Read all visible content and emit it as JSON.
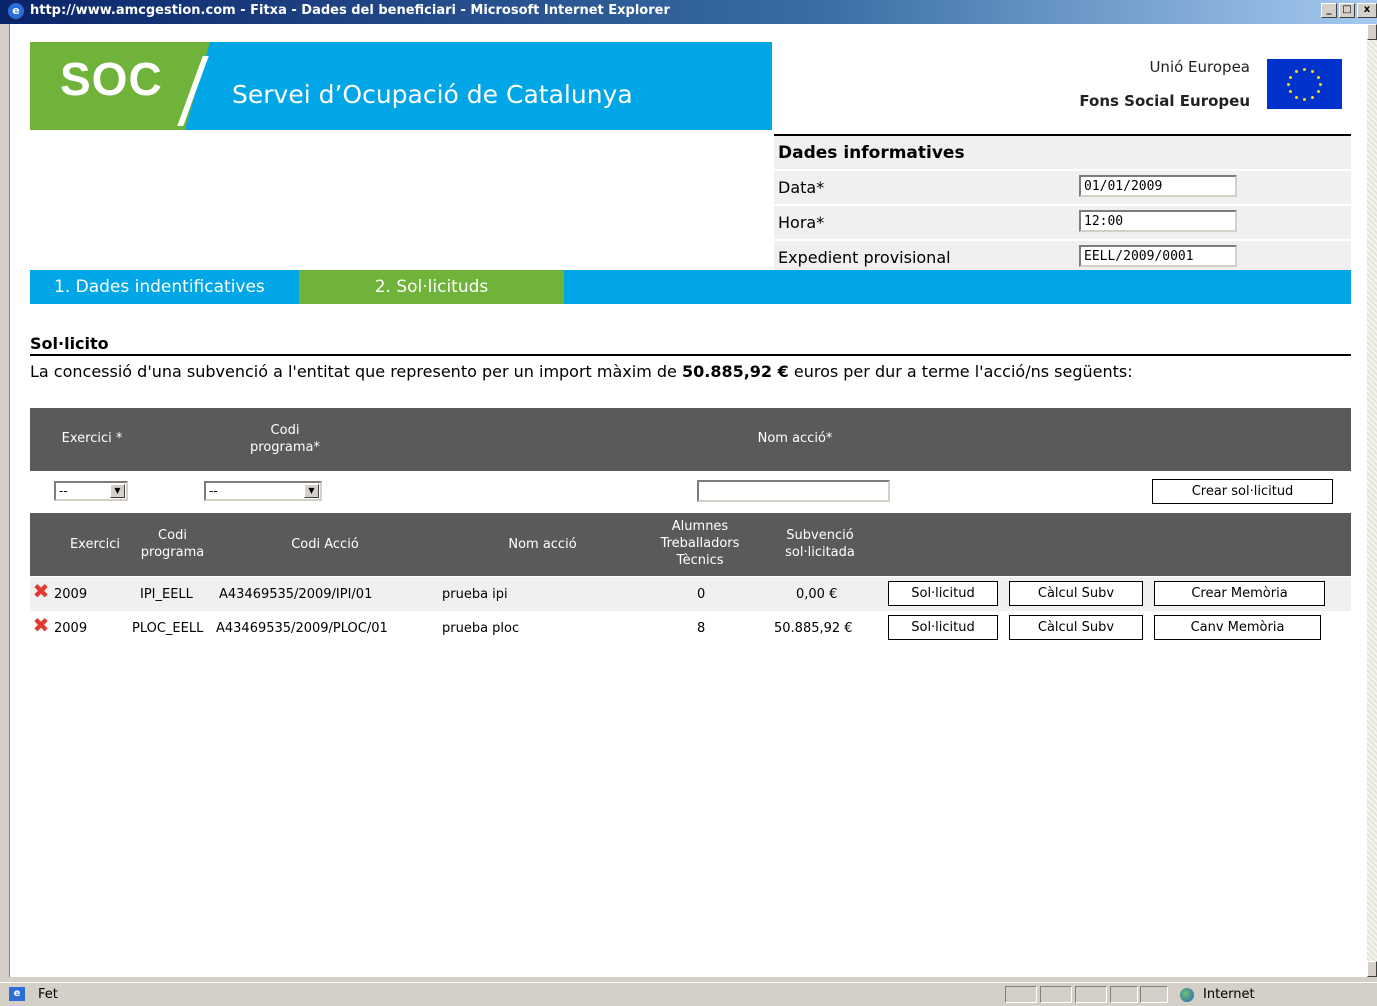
{
  "window": {
    "title": "http://www.amcgestion.com - Fitxa - Dades del beneficiari - Microsoft Internet Explorer",
    "min_glyph": "_",
    "max_glyph": "□",
    "close_glyph": "x",
    "ie_glyph": "e"
  },
  "header": {
    "logo_text": "SOC",
    "org_name": "Servei d’Ocupació de Catalunya",
    "eu_line1": "Unió Europea",
    "eu_line2": "Fons Social Europeu"
  },
  "info": {
    "heading": "Dades informatives",
    "fields": [
      {
        "label": "Data*",
        "value": "01/01/2009"
      },
      {
        "label": "Hora*",
        "value": "12:00"
      },
      {
        "label": "Expedient provisional",
        "value": "EELL/2009/0001"
      }
    ]
  },
  "tabs": [
    {
      "label": "1. Dades indentificatives"
    },
    {
      "label": "2. Sol·licituds"
    }
  ],
  "section": {
    "title": "Sol·licito",
    "intro_before": "La concessió d'una subvenció a l'entitat que represento per un import màxim de ",
    "intro_amount": "50.885,92 €",
    "intro_after": "  euros per dur a terme l'acció/ns següents:"
  },
  "filter": {
    "col_exercici": "Exercici *",
    "col_codi_line1": "Codi",
    "col_codi_line2": "programa*",
    "col_nom": "Nom acció*",
    "exercici_selected": "--",
    "codi_selected": "--",
    "nom_value": "",
    "create_button": "Crear sol·licitud"
  },
  "grid": {
    "headers": {
      "exercici": "Exercici",
      "codi_prog_1": "Codi",
      "codi_prog_2": "programa",
      "codi_accio": "Codi Acció",
      "nom_accio": "Nom acció",
      "alumnes_1": "Alumnes",
      "alumnes_2": "Treballadors",
      "alumnes_3": "Tècnics",
      "subv_1": "Subvenció",
      "subv_2": "sol·licitada"
    },
    "rows": [
      {
        "exercici": "2009",
        "codi_programa": "IPI_EELL",
        "codi_accio": "A43469535/2009/IPI/01",
        "nom_accio": "prueba ipi",
        "alumnes": "0",
        "subvencio": "0,00 €",
        "btn1": "Sol·licitud",
        "btn2": "Càlcul Subv",
        "btn3": "Crear Memòria"
      },
      {
        "exercici": "2009",
        "codi_programa": "PLOC_EELL",
        "codi_accio": "A43469535/2009/PLOC/01",
        "nom_accio": "prueba ploc",
        "alumnes": "8",
        "subvencio": "50.885,92 €",
        "btn1": "Sol·licitud",
        "btn2": "Càlcul Subv",
        "btn3": "Canv Memòria"
      }
    ],
    "delete_glyph": "✖"
  },
  "status": {
    "left_text": "Fet",
    "zone_text": "Internet"
  },
  "colors": {
    "soc_green": "#6fb33a",
    "soc_blue": "#00a6e6",
    "table_header": "#5a5a5a",
    "delete_red": "#e23a2f"
  }
}
